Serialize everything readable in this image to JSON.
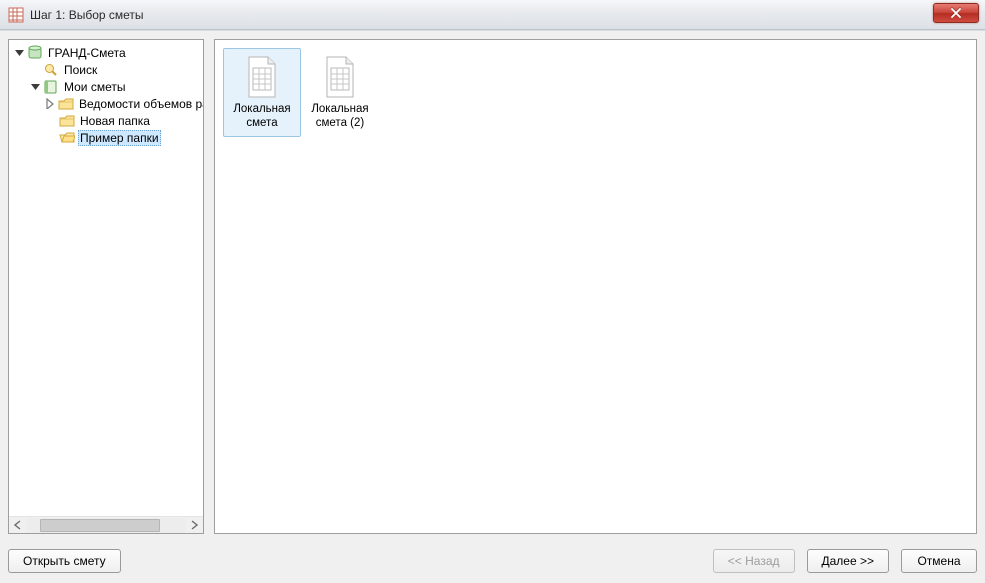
{
  "window": {
    "title": "Шаг 1: Выбор сметы"
  },
  "tree": {
    "root": {
      "label": "ГРАНД-Смета",
      "search": "Поиск",
      "my": "Мои сметы",
      "children": [
        "Ведомости объемов ра",
        "Новая папка",
        "Пример папки"
      ]
    }
  },
  "content": {
    "items": [
      {
        "line1": "Локальная",
        "line2": "смета",
        "selected": true
      },
      {
        "line1": "Локальная",
        "line2": "смета (2)",
        "selected": false
      }
    ]
  },
  "buttons": {
    "open": "Открыть смету",
    "back": "<< Назад",
    "next": "Далее >>",
    "cancel": "Отмена"
  }
}
